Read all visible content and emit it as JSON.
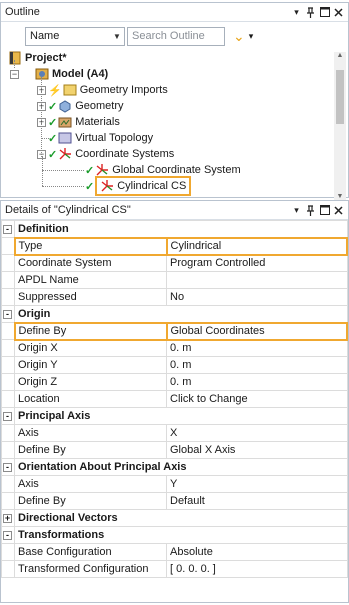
{
  "outline": {
    "title": "Outline",
    "name_combo": "Name",
    "search_placeholder": "Search Outline",
    "tree": [
      {
        "label": "Project*",
        "bold": true
      },
      {
        "label": "Model (A4)",
        "bold": true
      },
      {
        "label": "Geometry Imports"
      },
      {
        "label": "Geometry"
      },
      {
        "label": "Materials"
      },
      {
        "label": "Virtual Topology"
      },
      {
        "label": "Coordinate Systems"
      },
      {
        "label": "Global Coordinate System"
      },
      {
        "label": "Cylindrical CS"
      }
    ]
  },
  "details": {
    "title": "Details of \"Cylindrical CS\"",
    "rows": [
      {
        "kind": "cat",
        "label": "Definition",
        "expand": "-"
      },
      {
        "kind": "row",
        "label": "Type",
        "value": "Cylindrical",
        "highlight": true
      },
      {
        "kind": "row",
        "label": "Coordinate System",
        "value": "Program Controlled"
      },
      {
        "kind": "row",
        "label": "APDL Name",
        "value": ""
      },
      {
        "kind": "row",
        "label": "Suppressed",
        "value": "No"
      },
      {
        "kind": "cat",
        "label": "Origin",
        "expand": "-"
      },
      {
        "kind": "row",
        "label": "Define By",
        "value": "Global Coordinates",
        "highlight": true
      },
      {
        "kind": "row",
        "label": "Origin X",
        "value": "0. m"
      },
      {
        "kind": "row",
        "label": "Origin Y",
        "value": "0. m"
      },
      {
        "kind": "row",
        "label": "Origin Z",
        "value": "0. m"
      },
      {
        "kind": "row",
        "label": "Location",
        "value": "Click to Change"
      },
      {
        "kind": "cat",
        "label": "Principal Axis",
        "expand": "-"
      },
      {
        "kind": "row",
        "label": "Axis",
        "value": "X"
      },
      {
        "kind": "row",
        "label": "Define By",
        "value": "Global X Axis"
      },
      {
        "kind": "cat",
        "label": "Orientation About Principal Axis",
        "expand": "-"
      },
      {
        "kind": "row",
        "label": "Axis",
        "value": "Y"
      },
      {
        "kind": "row",
        "label": "Define By",
        "value": "Default"
      },
      {
        "kind": "cat",
        "label": "Directional Vectors",
        "expand": "+"
      },
      {
        "kind": "cat",
        "label": "Transformations",
        "expand": "-"
      },
      {
        "kind": "row",
        "label": "Base Configuration",
        "value": "Absolute"
      },
      {
        "kind": "row",
        "label": "Transformed Configuration",
        "value": "[ 0. 0. 0. ]"
      }
    ]
  },
  "icons": {
    "pin": "pin-icon",
    "maximize": "maximize-icon",
    "close": "close-icon"
  }
}
